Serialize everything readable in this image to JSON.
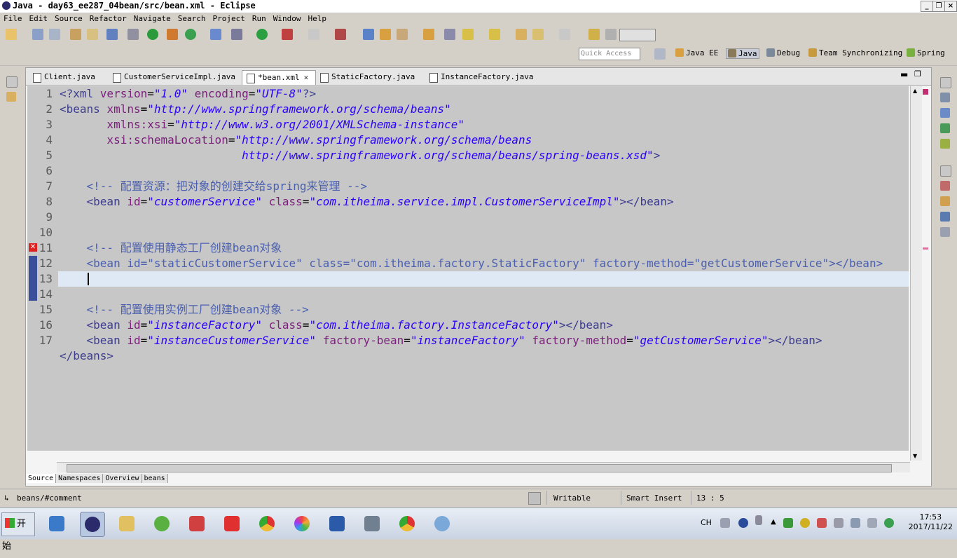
{
  "window": {
    "title": "Java - day63_ee287_04bean/src/bean.xml - Eclipse"
  },
  "menu": [
    "File",
    "Edit",
    "Source",
    "Refactor",
    "Navigate",
    "Search",
    "Project",
    "Run",
    "Window",
    "Help"
  ],
  "toolbar": {
    "quick_access_placeholder": "Quick Access"
  },
  "perspectives": [
    "Java EE",
    "Java",
    "Debug",
    "Team Synchronizing",
    "Spring"
  ],
  "editor": {
    "tabs": [
      {
        "label": "Client.java",
        "active": false
      },
      {
        "label": "CustomerServiceImpl.java",
        "active": false
      },
      {
        "label": "*bean.xml",
        "active": true
      },
      {
        "label": "StaticFactory.java",
        "active": false
      },
      {
        "label": "InstanceFactory.java",
        "active": false
      }
    ],
    "bottom_tabs": [
      "Source",
      "Namespaces",
      "Overview",
      "beans"
    ],
    "line_numbers": [
      "1",
      "2",
      "3",
      "4",
      "5",
      "6",
      "7",
      "8",
      "9",
      "10",
      "11",
      "12",
      "13",
      "14",
      "15",
      "16",
      "17"
    ],
    "code": {
      "l1_a": "<?xml ",
      "l1_b": "version",
      "l1_c": "=",
      "l1_d": "\"1.0\"",
      "l1_e": " encoding",
      "l1_f": "=",
      "l1_g": "\"UTF-8\"",
      "l1_h": "?>",
      "l2_a": "<beans ",
      "l2_b": "xmlns",
      "l2_c": "=",
      "l2_d": "\"http://www.springframework.org/schema/beans\"",
      "l3_a": "       xmlns:xsi",
      "l3_b": "=",
      "l3_c": "\"http://www.w3.org/2001/XMLSchema-instance\"",
      "l4_a": "       xsi:schemaLocation",
      "l4_b": "=",
      "l4_c": "\"http://www.springframework.org/schema/beans",
      "l5_a": "                           http://www.springframework.org/schema/beans/spring-beans.xsd\"",
      "l5_b": ">",
      "l7": "    <!-- 配置资源：把对象的创建交给spring来管理 -->",
      "l8_a": "    <bean ",
      "l8_b": "id",
      "l8_c": "=",
      "l8_d": "\"customerService\"",
      "l8_e": " class",
      "l8_f": "=",
      "l8_g": "\"com.itheima.service.impl.CustomerServiceImpl\"",
      "l8_h": "></bean>",
      "l11": "    <!-- 配置使用静态工厂创建bean对象",
      "l12_a": "    <bean ",
      "l12_b": "id=\"staticCustomerService\" class=\"com.itheima.factory.StaticFactory\" factory-method=\"getCustomerService\"></bean>",
      "l14": "    <!-- 配置使用实例工厂创建bean对象 -->",
      "l15_a": "    <bean ",
      "l15_b": "id",
      "l15_c": "=",
      "l15_d": "\"instanceFactory\"",
      "l15_e": " class",
      "l15_f": "=",
      "l15_g": "\"com.itheima.factory.InstanceFactory\"",
      "l15_h": "></bean>",
      "l16_a": "    <bean ",
      "l16_b": "id",
      "l16_c": "=",
      "l16_d": "\"instanceCustomerService\"",
      "l16_e": " factory-bean",
      "l16_f": "=",
      "l16_g": "\"instanceFactory\"",
      "l16_h": " factory-method",
      "l16_i": "=",
      "l16_j": "\"getCustomerService\"",
      "l16_k": "></bean>",
      "l17": "</beans>"
    }
  },
  "status": {
    "breadcrumb": "beans/#comment",
    "mode": "Writable",
    "insert": "Smart Insert",
    "position": "13 : 5"
  },
  "taskbar": {
    "start_label": "开始",
    "lang": "CH",
    "time": "17:53",
    "date": "2017/11/22"
  }
}
